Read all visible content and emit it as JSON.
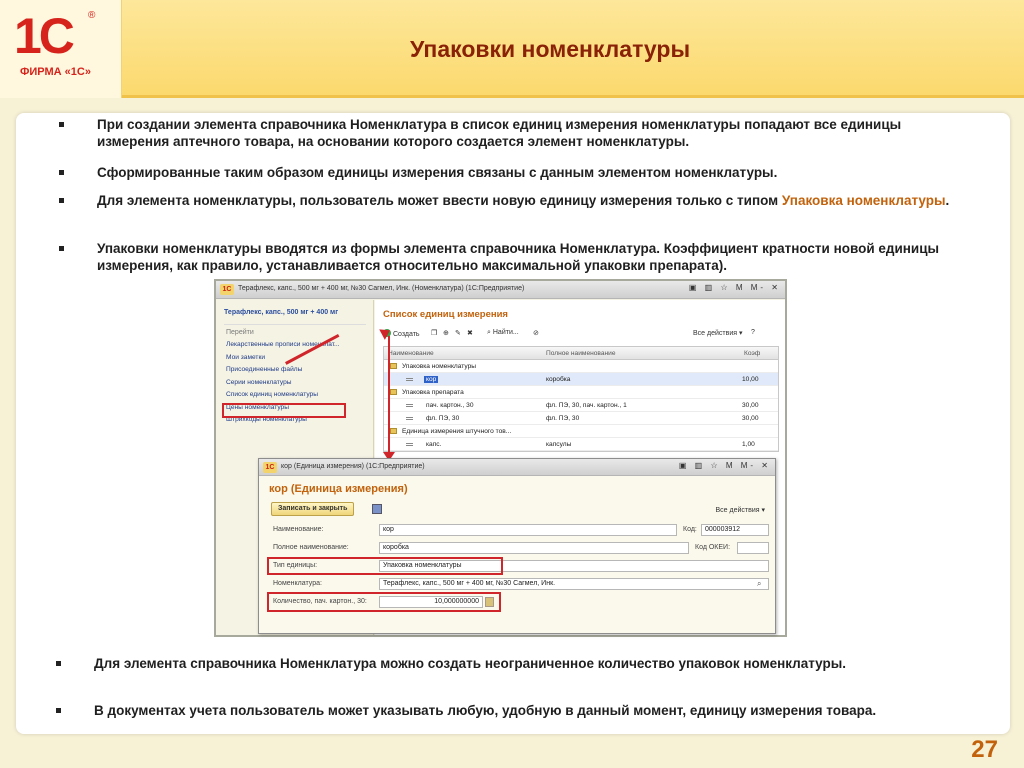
{
  "logo": {
    "mark": "1C",
    "reg": "®",
    "firm": "ФИРМА «1С»"
  },
  "title": "Упаковки номенклатуры",
  "bullets_top": [
    "При создании элемента справочника  Номенклатура в список единиц измерения номенклатуры попадают все единицы измерения аптечного товара, на основании которого создается элемент номенклатуры.",
    "Сформированные таким образом единицы измерения связаны с данным элементом номенклатуры.",
    {
      "text": "Для элемента номенклатуры, пользователь может ввести новую единицу измерения только с типом ",
      "highlight": "Упаковка номенклатуры",
      "tail": "."
    },
    "Упаковки номенклатуры вводятся из формы элемента справочника Номенклатура. Коэффициент кратности новой единицы измерения, как правило, устанавливается относительно максимальной упаковки препарата)."
  ],
  "bullets_bottom": [
    "Для элемента справочника Номенклатура можно создать неограниченное количество упаковок номенклатуры.",
    "В документах учета пользователь может указывать любую, удобную в данный момент, единицу измерения товара."
  ],
  "page_number": "27",
  "screenshot": {
    "window_title": "Терафлекс, капс., 500 мг + 400 мг, №30 Сагмел, Инк. (Номенклатура)  (1С:Предприятие)",
    "window_buttons": "▣ ▥ ☆ M M- ✕",
    "nav": {
      "title": "Терафлекс, капс., 500 мг + 400 мг",
      "section": "Перейти",
      "items": [
        "Лекарственные прописи номенклат...",
        "Мои заметки",
        "Присоединенные файлы",
        "Серии номенклатуры",
        "Список единиц номенклатуры",
        "Цены номенклатуры",
        "Штрихкоды номенклатуры"
      ]
    },
    "list": {
      "title": "Список единиц измерения",
      "create": "Создать",
      "find": "Найти...",
      "all_actions": "Все действия ▾",
      "columns": [
        "Наименование",
        "Полное наименование",
        "Коэф"
      ],
      "rows": [
        {
          "name": "Упаковка номенклатуры",
          "full": "",
          "coef": "",
          "group": true
        },
        {
          "name": "кор",
          "full": "коробка",
          "coef": "10,00",
          "group": false,
          "selected": true
        },
        {
          "name": "Упаковка препарата",
          "full": "",
          "coef": "",
          "group": true
        },
        {
          "name": "пач. картон., 30",
          "full": "фл. ПЭ, 30, пач. картон., 1",
          "coef": "30,00",
          "group": false
        },
        {
          "name": "фл. ПЭ, 30",
          "full": "фл. ПЭ, 30",
          "coef": "30,00",
          "group": false
        },
        {
          "name": "Единица измерения штучного тов...",
          "full": "",
          "coef": "",
          "group": true
        },
        {
          "name": "капс.",
          "full": "капсулы",
          "coef": "1,00",
          "group": false
        }
      ]
    }
  },
  "popup": {
    "window_title": "кор (Единица измерения)  (1С:Предприятие)",
    "window_buttons": "▣ ▥ ☆ M M- ✕",
    "form_title": "кор (Единица измерения)",
    "save_close": "Записать и закрыть",
    "all_actions": "Все действия ▾",
    "fields": {
      "name_label": "Наименование:",
      "name_value": "кор",
      "code_label": "Код:",
      "code_value": "000003912",
      "full_label": "Полное наименование:",
      "full_value": "коробка",
      "okei_label": "Код ОКЕИ:",
      "okei_value": "",
      "type_label": "Тип единицы:",
      "type_value": "Упаковка номенклатуры",
      "nom_label": "Номенклатура:",
      "nom_value": "Терафлекс, капс., 500 мг + 400 мг, №30 Сагмел, Инк.",
      "qty_label": "Количество, пач. картон., 30:",
      "qty_value": "10,000000000"
    }
  },
  "colors": {
    "accent": "#c2620c",
    "title": "#8a2208",
    "brand": "#d6231b",
    "annotation": "#d0262b",
    "header": "#fbd96e"
  }
}
